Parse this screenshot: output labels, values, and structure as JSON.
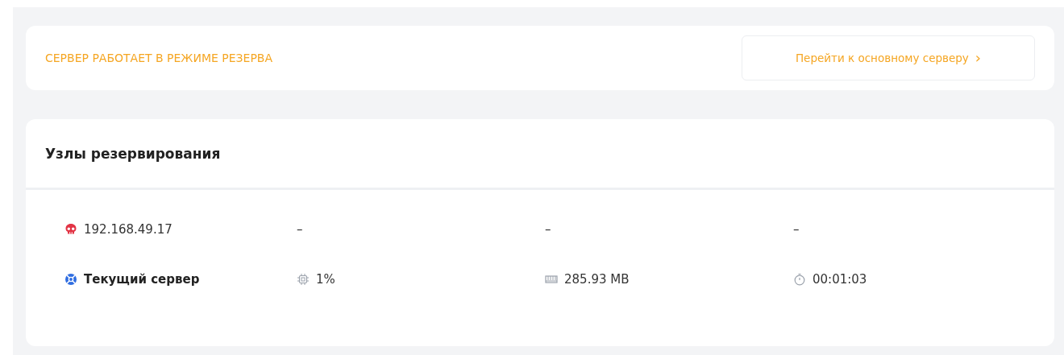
{
  "status_card": {
    "message": "СЕРВЕР РАБОТАЕТ В РЕЖИМЕ РЕЗЕРВА",
    "action": "Перейти к основному серверу",
    "action_icon": "›"
  },
  "nodes_card": {
    "title": "Узлы резервирования",
    "rows": [
      {
        "kind": "offline",
        "name": "192.168.49.17",
        "metrics": [
          {
            "value": "–"
          },
          {
            "value": "–"
          },
          {
            "value": "–"
          }
        ]
      },
      {
        "kind": "current",
        "name": "Текущий сервер",
        "metrics": [
          {
            "kind": "cpu",
            "value": "1%"
          },
          {
            "kind": "memory",
            "value": "285.93 MB"
          },
          {
            "kind": "uptime",
            "value": "00:01:03"
          }
        ]
      }
    ]
  }
}
